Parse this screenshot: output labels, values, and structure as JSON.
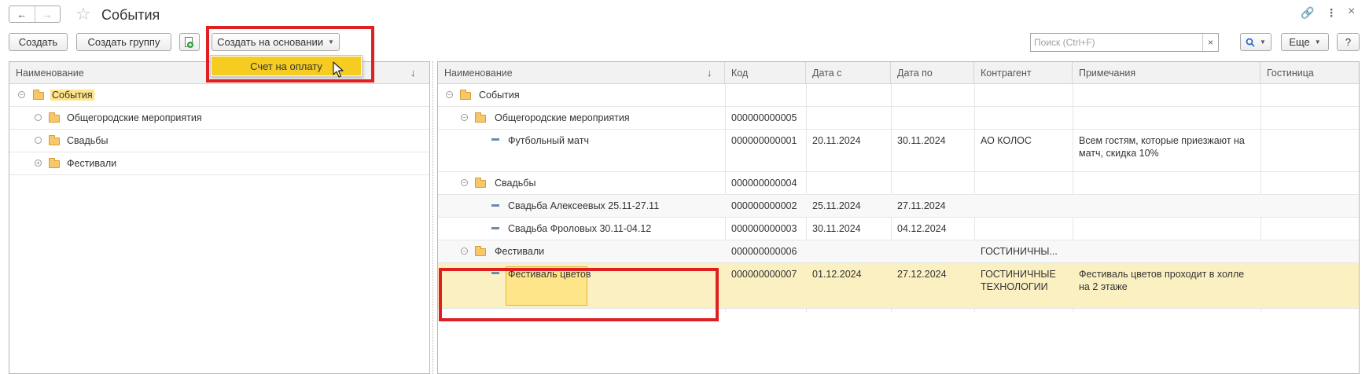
{
  "window": {
    "title": "События",
    "back_icon": "←",
    "forward_icon": "→",
    "favorite_icon": "☆",
    "link_icon": "🔗",
    "menu_icon": "⋮",
    "close_icon": "×"
  },
  "toolbar": {
    "create_label": "Создать",
    "create_group_label": "Создать группу",
    "create_based_on_label": "Создать на основании",
    "more_label": "Еще",
    "help_label": "?",
    "search_placeholder": "Поиск (Ctrl+F)",
    "search_clear": "×",
    "search_icon": "🔍"
  },
  "dropdown": {
    "items": [
      {
        "label": "Счет на оплату"
      }
    ]
  },
  "left_panel": {
    "header": {
      "name": "Наименование",
      "sort": "↓"
    },
    "rows": [
      {
        "label": "События",
        "expander": "⊖"
      },
      {
        "label": "Общегородские мероприятия",
        "expander": "○"
      },
      {
        "label": "Свадьбы",
        "expander": "○"
      },
      {
        "label": "Фестивали",
        "expander": "⊕"
      }
    ]
  },
  "right_panel": {
    "columns": [
      "Наименование",
      "Код",
      "Дата с",
      "Дата по",
      "Контрагент",
      "Примечания",
      "Гостиница"
    ],
    "sort": "↓",
    "rows": [
      {
        "name": "События",
        "code": "",
        "date_from": "",
        "date_to": "",
        "counterparty": "",
        "notes": "",
        "hotel": ""
      },
      {
        "name": "Общегородские мероприятия",
        "code": "000000000005",
        "date_from": "",
        "date_to": "",
        "counterparty": "",
        "notes": "",
        "hotel": ""
      },
      {
        "name": "Футбольный матч",
        "code": "000000000001",
        "date_from": "20.11.2024",
        "date_to": "30.11.2024",
        "counterparty": "АО КОЛОС",
        "notes": "Всем гостям, которые приезжают на матч, скидка 10%",
        "hotel": ""
      },
      {
        "name": "Свадьбы",
        "code": "000000000004",
        "date_from": "",
        "date_to": "",
        "counterparty": "",
        "notes": "",
        "hotel": ""
      },
      {
        "name": "Свадьба Алексеевых 25.11-27.11",
        "code": "000000000002",
        "date_from": "25.11.2024",
        "date_to": "27.11.2024",
        "counterparty": "",
        "notes": "",
        "hotel": ""
      },
      {
        "name": "Свадьба Фроловых 30.11-04.12",
        "code": "000000000003",
        "date_from": "30.11.2024",
        "date_to": "04.12.2024",
        "counterparty": "",
        "notes": "",
        "hotel": ""
      },
      {
        "name": "Фестивали",
        "code": "000000000006",
        "date_from": "",
        "date_to": "",
        "counterparty": "ГОСТИНИЧНЫ...",
        "notes": "",
        "hotel": ""
      },
      {
        "name": "Фестиваль цветов",
        "code": "000000000007",
        "date_from": "01.12.2024",
        "date_to": "27.12.2024",
        "counterparty": "ГОСТИНИЧНЫЕ ТЕХНОЛОГИИ",
        "notes": "Фестиваль цветов проходит в холле на 2 этаже",
        "hotel": ""
      }
    ]
  },
  "colors": {
    "accent_yellow": "#f5cc1f",
    "selected_row": "#fbf0c2",
    "highlight_red": "#e02020"
  }
}
